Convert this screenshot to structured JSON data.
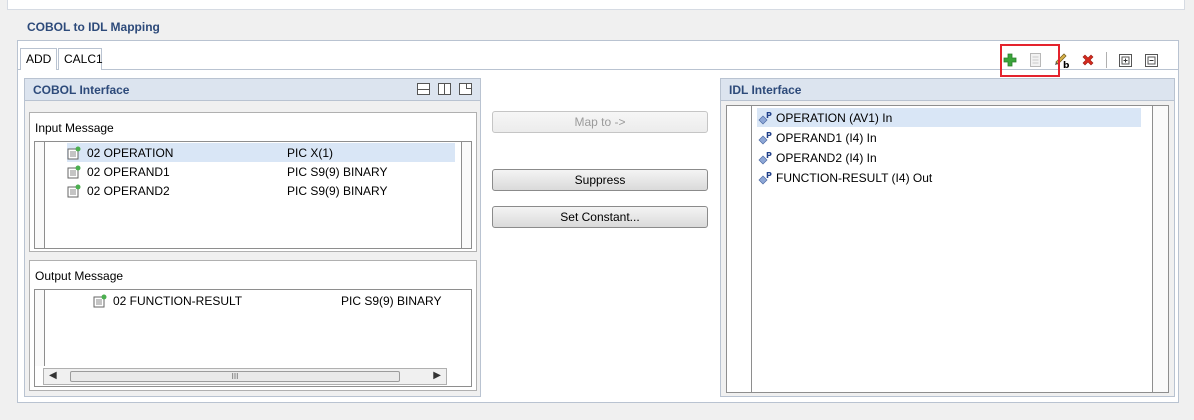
{
  "main": {
    "title": "COBOL to IDL Mapping"
  },
  "tabs": [
    {
      "label": "ADD"
    },
    {
      "label": "CALC1"
    }
  ],
  "toolbar": {
    "icons": [
      "plus-icon",
      "copy-icon",
      "rename-icon",
      "delete-icon",
      "expand-all-icon",
      "collapse-all-icon"
    ]
  },
  "cobol_interface": {
    "title": "COBOL Interface",
    "input_message": {
      "label": "Input Message",
      "rows": [
        {
          "name": "02 OPERATION",
          "pic": "PIC X(1)"
        },
        {
          "name": "02 OPERAND1",
          "pic": "PIC S9(9) BINARY"
        },
        {
          "name": "02 OPERAND2",
          "pic": "PIC S9(9) BINARY"
        }
      ]
    },
    "output_message": {
      "label": "Output Message",
      "rows": [
        {
          "name": "02 FUNCTION-RESULT",
          "pic": "PIC S9(9) BINARY"
        }
      ]
    },
    "scroll_thumb": "III"
  },
  "buttons": {
    "map_to": "Map to ->",
    "suppress": "Suppress",
    "set_constant": "Set Constant..."
  },
  "idl_interface": {
    "title": "IDL Interface",
    "rows": [
      {
        "label": "OPERATION  (AV1) In"
      },
      {
        "label": "OPERAND1  (I4) In"
      },
      {
        "label": "OPERAND2  (I4) In"
      },
      {
        "label": "FUNCTION-RESULT  (I4)  Out"
      }
    ]
  },
  "colors": {
    "accent": "#2d4a7a",
    "header_bg": "#dce4ef",
    "selection": "#d9e6f6",
    "highlight": "#e4232d",
    "plus_green": "#3aa53a",
    "delete_red": "#d42a1e"
  }
}
